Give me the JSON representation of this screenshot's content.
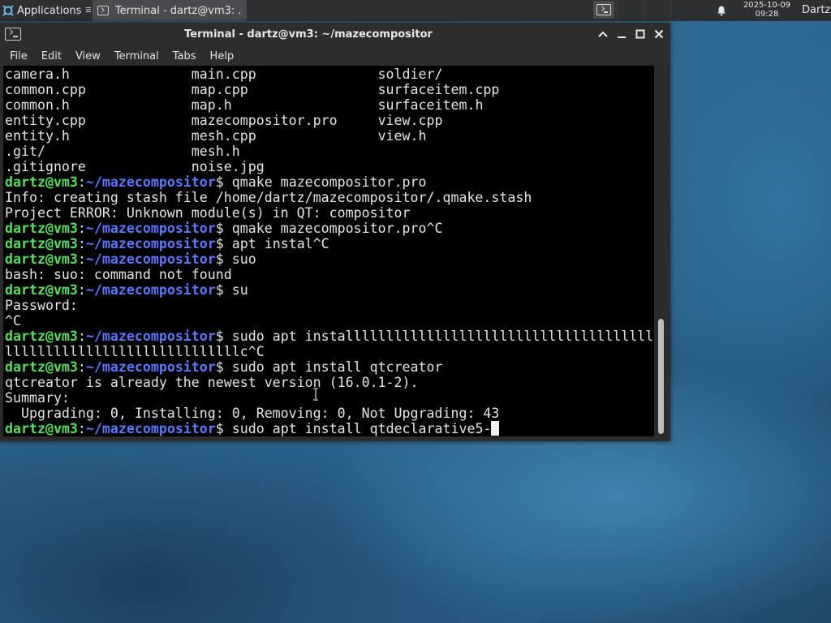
{
  "panel": {
    "applications_label": "Applications",
    "task_label": "Terminal - dartz@vm3: ...",
    "clock_date": "2025-10-09",
    "clock_time": "09:28",
    "user": "Dartz",
    "icons": [
      "applications-icon",
      "terminal-icon",
      "bell-icon"
    ]
  },
  "window": {
    "title": "Terminal - dartz@vm3: ~/mazecompositor",
    "menu": [
      "File",
      "Edit",
      "View",
      "Terminal",
      "Tabs",
      "Help"
    ]
  },
  "terminal": {
    "prompt_user": "dartz@vm3",
    "prompt_sep": ":",
    "prompt_path": "~/mazecompositor",
    "prompt_end": "$ ",
    "listing": [
      [
        "camera.h",
        "main.cpp",
        "soldier/"
      ],
      [
        "common.cpp",
        "map.cpp",
        "surfaceitem.cpp"
      ],
      [
        "common.h",
        "map.h",
        "surfaceitem.h"
      ],
      [
        "entity.cpp",
        "mazecompositor.pro",
        "view.cpp"
      ],
      [
        "entity.h",
        "mesh.cpp",
        "view.h"
      ],
      [
        ".git/",
        "mesh.h",
        ""
      ],
      [
        ".gitignore",
        "noise.jpg",
        ""
      ]
    ],
    "lines": [
      {
        "prompt": true,
        "text": "qmake mazecompositor.pro"
      },
      {
        "prompt": false,
        "text": "Info: creating stash file /home/dartz/mazecompositor/.qmake.stash"
      },
      {
        "prompt": false,
        "text": "Project ERROR: Unknown module(s) in QT: compositor"
      },
      {
        "prompt": true,
        "text": "qmake mazecompositor.pro^C"
      },
      {
        "prompt": true,
        "text": "apt instal^C"
      },
      {
        "prompt": true,
        "text": "suo"
      },
      {
        "prompt": false,
        "text": "bash: suo: command not found"
      },
      {
        "prompt": true,
        "text": "su"
      },
      {
        "prompt": false,
        "text": "Password:"
      },
      {
        "prompt": false,
        "text": "^C"
      },
      {
        "prompt": true,
        "text": "sudo apt installllllllllllllllllllllllllllllllllllll"
      },
      {
        "prompt": false,
        "text": "lllllllllllllllllllllllllllllc^C"
      },
      {
        "prompt": true,
        "text": "sudo apt install qtcreator"
      },
      {
        "prompt": false,
        "text": "qtcreator is already the newest version (16.0.1-2)."
      },
      {
        "prompt": false,
        "text": "Summary:"
      },
      {
        "prompt": false,
        "text": "  Upgrading: 0, Installing: 0, Removing: 0, Not Upgrading: 43"
      },
      {
        "prompt": true,
        "text": "sudo apt install qtdeclarative5-",
        "cursor": true
      }
    ]
  }
}
